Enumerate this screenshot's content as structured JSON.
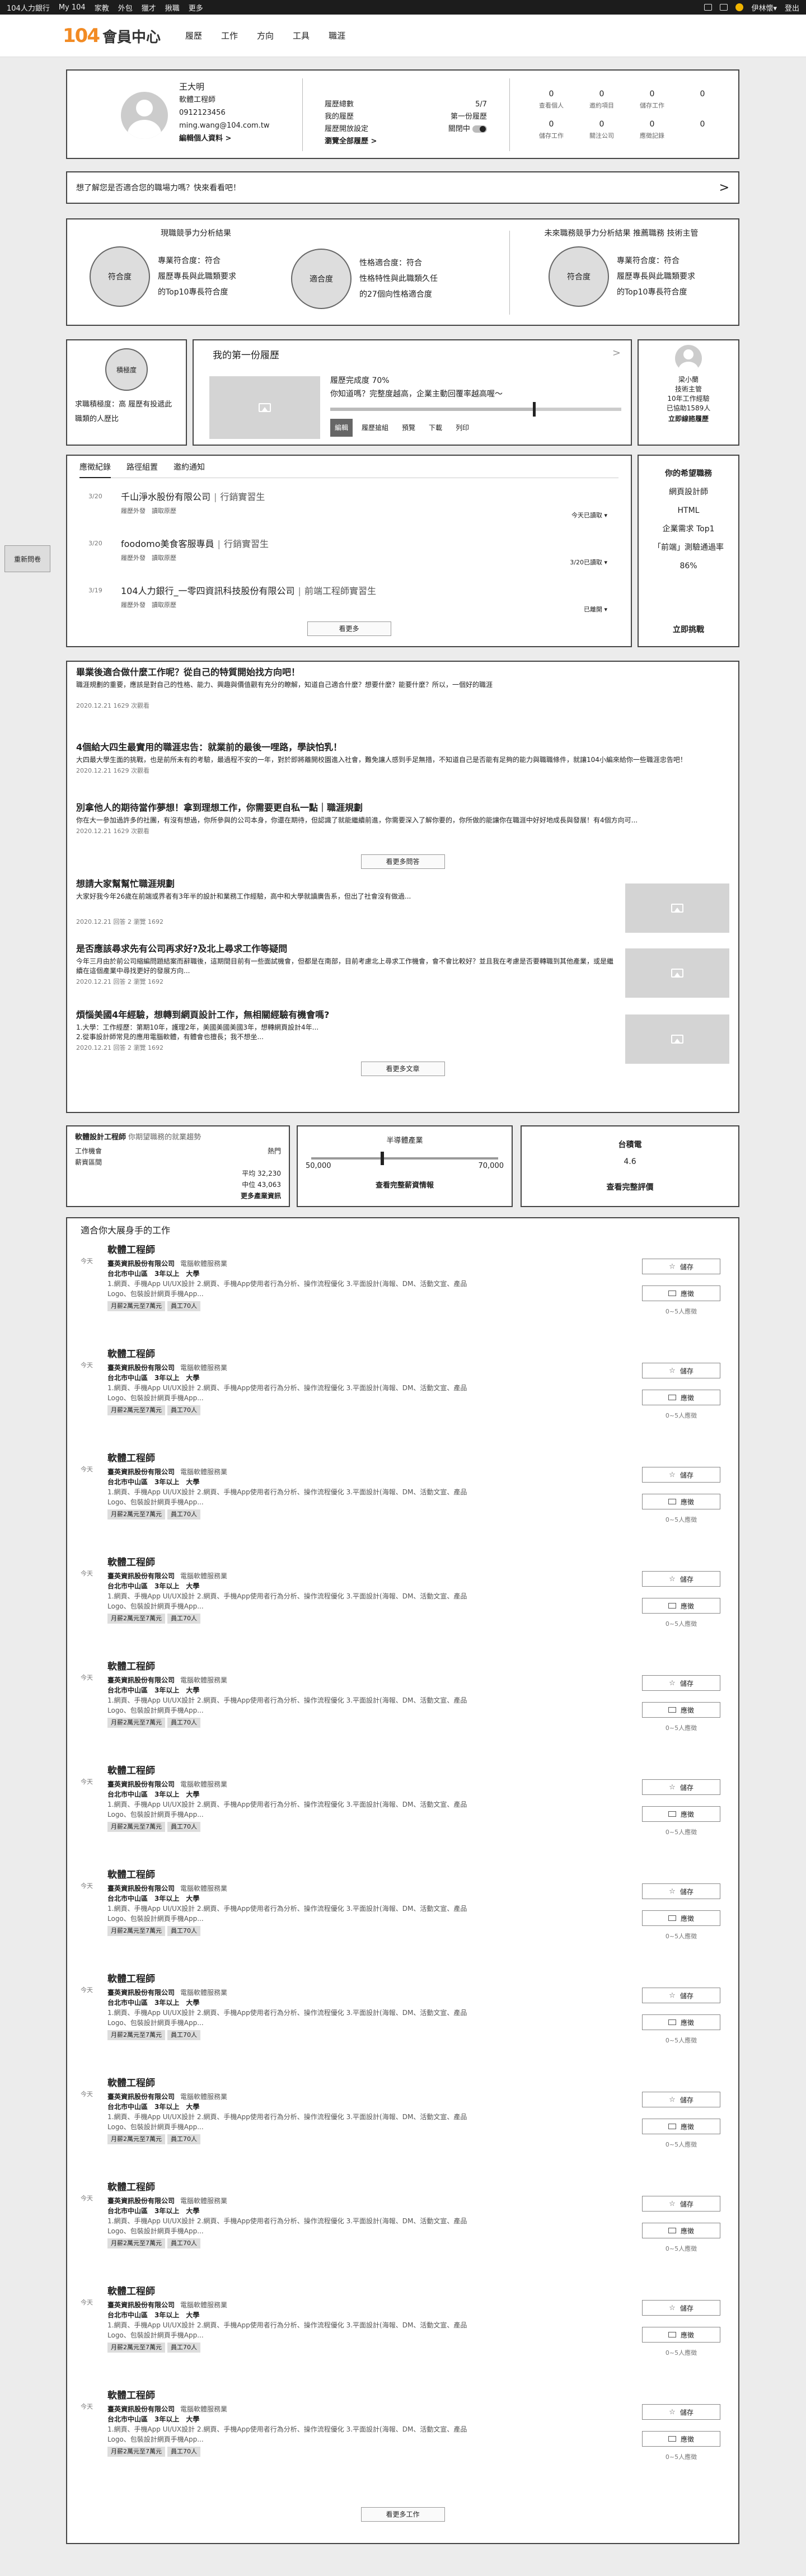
{
  "topbar": {
    "brand": "104人力銀行",
    "my": "My 104",
    "links": [
      "家教",
      "外包",
      "獵才",
      "揪職",
      "更多"
    ],
    "user": "伊林懷▾",
    "logout": "登出"
  },
  "header": {
    "logo_num": "104",
    "logo_text": "會員中心",
    "nav": [
      "履歷",
      "工作",
      "方向",
      "工具",
      "職涯"
    ]
  },
  "profile": {
    "name": "王大明",
    "title": "軟體工程師",
    "phone": "0912123456",
    "email": "ming.wang@104.com.tw",
    "edit": "編輯個人資料 >",
    "stats": [
      {
        "label": "履歷總數",
        "value": "5/7"
      },
      {
        "label": "我的履歷",
        "value": "第一份履歷"
      },
      {
        "label": "履歷開放設定",
        "value": "關閉中"
      }
    ],
    "view_settings": "瀏覽全部履歷 >",
    "counts": [
      {
        "n": "0",
        "l": "查看個人"
      },
      {
        "n": "0",
        "l": "邀約項目"
      },
      {
        "n": "0",
        "l": "儲存工作"
      },
      {
        "n": "0",
        "l": ""
      },
      {
        "n": "0",
        "l": "儲存工作"
      },
      {
        "n": "0",
        "l": "關注公司"
      },
      {
        "n": "0",
        "l": "應徵記錄"
      },
      {
        "n": "0",
        "l": ""
      }
    ]
  },
  "banner": {
    "text": "想了解您是否適合您的職場力嗎？快來看看吧！",
    "arrow": ">"
  },
  "analysis": [
    {
      "title": "現職競爭力分析結果",
      "circle": "符合度",
      "lines": [
        "專業符合度：符合",
        "履歷專長與此職類要求",
        "的Top10專長符合度"
      ]
    },
    {
      "title": "",
      "circle": "適合度",
      "lines": [
        "性格適合度：符合",
        "性格特性與此職類久任",
        "的27個向性格適合度"
      ]
    },
    {
      "title": "未來職務競爭力分析結果 推薦職務 技術主管",
      "circle": "符合度",
      "lines": [
        "專業符合度：符合",
        "履歷專長與此職類要求",
        "的Top10專長符合度"
      ]
    }
  ],
  "fortune": {
    "circle": "積極度",
    "text": "求職積極度：高 履歷有投遞此職類的人歷比"
  },
  "resume": {
    "title": "我的第一份履歷",
    "arrow": ">",
    "complete": "履歷完成度 70%",
    "hint": "你知道嗎？完整度越高，企業主動回覆率越高喔～",
    "progress": 0.7,
    "buttons": [
      "編輯",
      "履歷搶組",
      "預覽",
      "下載",
      "列印"
    ]
  },
  "advisor": {
    "name": "梁小蘭",
    "role": "技術主管",
    "years": "10年工作經驗",
    "helped": "已協助1589人",
    "link": "立即線諮履歷"
  },
  "side_button": "重新問卷",
  "records": {
    "tabs": [
      "應徵紀錄",
      "路徑組置",
      "邀約通知"
    ],
    "items": [
      {
        "date": "3/20",
        "company": "千山淨水股份有限公司",
        "job": "行銷實習生",
        "sub": "履歷外發　讀取原歷",
        "status": "今天已讀取 ▾"
      },
      {
        "date": "3/20",
        "company": "foodomo美食客服專員",
        "job": "行銷實習生",
        "sub": "履歷外發　讀取原歷",
        "status": "3/20已讀取 ▾"
      },
      {
        "date": "3/19",
        "company": "104人力銀行_一零四資訊科技股份有限公司",
        "job": "前端工程師實習生",
        "sub": "履歷外發　讀取原歷",
        "status": "已離開 ▾"
      }
    ],
    "more": "看更多"
  },
  "wish": {
    "title": "你的希望職務",
    "lines": [
      "網頁設計師",
      "HTML",
      "企業需求 Top1",
      "「前端」測驗通過率",
      "86%"
    ],
    "link": "立即挑戰"
  },
  "articles": {
    "items": [
      {
        "title": "畢業後適合做什麼工作呢？從自己的特質開始找方向吧！",
        "body": "職涯規劃的重要，應該是對自己的性格、能力、興趣與價值觀有充分的瞭解，知道自己適合什麼？想要什麼？能要什麼？所以，一個好的職涯",
        "meta": "2020.12.21 1629 次觀看"
      },
      {
        "title": "4個給大四生最實用的職涯忠告：就業前的最後一哩路，學訣怕乳！",
        "body": "大四最大學生面的挑戰，也是前所未有的考驗，最過程不安的一年，對於即將離開校園進入社會，難免讓人感到手足無措，不知道自己是否能有足夠的能力與職職條件，就讓104小編來給你一些職涯忠告吧！",
        "meta": "2020.12.21 1629 次觀看"
      },
      {
        "title": "別拿他人的期待當作夢想！拿到理想工作，你需要更自私一點｜職涯規劃",
        "body": "你在大一參加過許多的社團，有沒有想過，你所參與的公司本身，你還在期待，但認識了就能繼續前進，你需要深入了解你要的，你所做的能讓你在職涯中好好地成長與發展！有4個方向可...",
        "meta": "2020.12.21 1629 次觀看"
      }
    ],
    "more1": "看更多問答",
    "qa": [
      {
        "title": "想請大家幫幫忙職涯規劃",
        "body": "大家好我今年26歲在前端或界者有3年半的設計和業務工作經驗，高中和大學就讀廣告系，但出了社會沒有做過...",
        "meta": "2020.12.21 回答 2 瀏覽 1692"
      },
      {
        "title": "是否應該尋求先有公司再求好?及北上尋求工作等疑問",
        "body": "今年三月由於前公司縮編問題結案而辭職後，這期間目前有一些面試機會，但都是在南部，目前考慮北上尋求工作機會，會不會比較好？並且我在考慮是否要轉職到其他產業，或是繼續在這個產業中尋找更好的發展方向...",
        "meta": "2020.12.21 回答 2 瀏覽 1692"
      },
      {
        "title": "煩惱美國4年經驗，想轉到網頁設計工作，無相關經驗有機會嗎?",
        "body": "1.大學：工作經歷：第期10年，護理2年，美國美國美國3年，想轉網頁設計4年...\n2.從事設計師常見的應用電腦軟體，有體會也擅長；我不想坐...",
        "meta": "2020.12.21 回答 2 瀏覽 1692"
      }
    ],
    "more2": "看更多文章"
  },
  "salary": {
    "job": "軟體設計工程師",
    "suffix": "你期望職務的就業趨勢",
    "rows": [
      {
        "label": "工作機會",
        "value": "熱門"
      },
      {
        "label": "薪資區間",
        "value": ""
      },
      {
        "label": "",
        "value": "平均 32,230"
      },
      {
        "label": "",
        "value": "中位 43,063"
      }
    ],
    "link": "更多產業資訊"
  },
  "range": {
    "title": "半導體產業",
    "min": "50,000",
    "max": "70,000",
    "position": 0.38,
    "link": "查看完整薪資情報"
  },
  "company": {
    "name": "台積電",
    "score": "4.6",
    "link": "查看完整評價"
  },
  "jobs": {
    "title": "適合你大展身手的工作",
    "items": [
      {
        "date": "今天",
        "name": "軟體工程師",
        "company": "臺英資訊股份有限公司",
        "category": "電腦軟體服務業",
        "location": "台北市中山區　3年以上　大學",
        "desc": "1.網頁、手機App UI/UX設計 2.網頁、手機App使用者行為分析、操作流程優化 3.平面設計(海報、DM、活動文宣、產品Logo、包裝設計網頁手機App...",
        "tags": [
          "月薪2萬元至7萬元",
          "員工70人"
        ],
        "save": "儲存",
        "apply": "應徵",
        "applicants": "0~5人應徵"
      },
      {
        "date": "今天",
        "name": "軟體工程師",
        "company": "臺英資訊股份有限公司",
        "category": "電腦軟體服務業",
        "location": "台北市中山區　3年以上　大學",
        "desc": "1.網頁、手機App UI/UX設計 2.網頁、手機App使用者行為分析、操作流程優化 3.平面設計(海報、DM、活動文宣、產品Logo、包裝設計網頁手機App...",
        "tags": [
          "月薪2萬元至7萬元",
          "員工70人"
        ],
        "save": "儲存",
        "apply": "應徵",
        "applicants": "0~5人應徵"
      },
      {
        "date": "今天",
        "name": "軟體工程師",
        "company": "臺英資訊股份有限公司",
        "category": "電腦軟體服務業",
        "location": "台北市中山區　3年以上　大學",
        "desc": "1.網頁、手機App UI/UX設計 2.網頁、手機App使用者行為分析、操作流程優化 3.平面設計(海報、DM、活動文宣、產品Logo、包裝設計網頁手機App...",
        "tags": [
          "月薪2萬元至7萬元",
          "員工70人"
        ],
        "save": "儲存",
        "apply": "應徵",
        "applicants": "0~5人應徵"
      },
      {
        "date": "今天",
        "name": "軟體工程師",
        "company": "臺英資訊股份有限公司",
        "category": "電腦軟體服務業",
        "location": "台北市中山區　3年以上　大學",
        "desc": "1.網頁、手機App UI/UX設計 2.網頁、手機App使用者行為分析、操作流程優化 3.平面設計(海報、DM、活動文宣、產品Logo、包裝設計網頁手機App...",
        "tags": [
          "月薪2萬元至7萬元",
          "員工70人"
        ],
        "save": "儲存",
        "apply": "應徵",
        "applicants": "0~5人應徵"
      },
      {
        "date": "今天",
        "name": "軟體工程師",
        "company": "臺英資訊股份有限公司",
        "category": "電腦軟體服務業",
        "location": "台北市中山區　3年以上　大學",
        "desc": "1.網頁、手機App UI/UX設計 2.網頁、手機App使用者行為分析、操作流程優化 3.平面設計(海報、DM、活動文宣、產品Logo、包裝設計網頁手機App...",
        "tags": [
          "月薪2萬元至7萬元",
          "員工70人"
        ],
        "save": "儲存",
        "apply": "應徵",
        "applicants": "0~5人應徵"
      },
      {
        "date": "今天",
        "name": "軟體工程師",
        "company": "臺英資訊股份有限公司",
        "category": "電腦軟體服務業",
        "location": "台北市中山區　3年以上　大學",
        "desc": "1.網頁、手機App UI/UX設計 2.網頁、手機App使用者行為分析、操作流程優化 3.平面設計(海報、DM、活動文宣、產品Logo、包裝設計網頁手機App...",
        "tags": [
          "月薪2萬元至7萬元",
          "員工70人"
        ],
        "save": "儲存",
        "apply": "應徵",
        "applicants": "0~5人應徵"
      },
      {
        "date": "今天",
        "name": "軟體工程師",
        "company": "臺英資訊股份有限公司",
        "category": "電腦軟體服務業",
        "location": "台北市中山區　3年以上　大學",
        "desc": "1.網頁、手機App UI/UX設計 2.網頁、手機App使用者行為分析、操作流程優化 3.平面設計(海報、DM、活動文宣、產品Logo、包裝設計網頁手機App...",
        "tags": [
          "月薪2萬元至7萬元",
          "員工70人"
        ],
        "save": "儲存",
        "apply": "應徵",
        "applicants": "0~5人應徵"
      },
      {
        "date": "今天",
        "name": "軟體工程師",
        "company": "臺英資訊股份有限公司",
        "category": "電腦軟體服務業",
        "location": "台北市中山區　3年以上　大學",
        "desc": "1.網頁、手機App UI/UX設計 2.網頁、手機App使用者行為分析、操作流程優化 3.平面設計(海報、DM、活動文宣、產品Logo、包裝設計網頁手機App...",
        "tags": [
          "月薪2萬元至7萬元",
          "員工70人"
        ],
        "save": "儲存",
        "apply": "應徵",
        "applicants": "0~5人應徵"
      },
      {
        "date": "今天",
        "name": "軟體工程師",
        "company": "臺英資訊股份有限公司",
        "category": "電腦軟體服務業",
        "location": "台北市中山區　3年以上　大學",
        "desc": "1.網頁、手機App UI/UX設計 2.網頁、手機App使用者行為分析、操作流程優化 3.平面設計(海報、DM、活動文宣、產品Logo、包裝設計網頁手機App...",
        "tags": [
          "月薪2萬元至7萬元",
          "員工70人"
        ],
        "save": "儲存",
        "apply": "應徵",
        "applicants": "0~5人應徵"
      },
      {
        "date": "今天",
        "name": "軟體工程師",
        "company": "臺英資訊股份有限公司",
        "category": "電腦軟體服務業",
        "location": "台北市中山區　3年以上　大學",
        "desc": "1.網頁、手機App UI/UX設計 2.網頁、手機App使用者行為分析、操作流程優化 3.平面設計(海報、DM、活動文宣、產品Logo、包裝設計網頁手機App...",
        "tags": [
          "月薪2萬元至7萬元",
          "員工70人"
        ],
        "save": "儲存",
        "apply": "應徵",
        "applicants": "0~5人應徵"
      },
      {
        "date": "今天",
        "name": "軟體工程師",
        "company": "臺英資訊股份有限公司",
        "category": "電腦軟體服務業",
        "location": "台北市中山區　3年以上　大學",
        "desc": "1.網頁、手機App UI/UX設計 2.網頁、手機App使用者行為分析、操作流程優化 3.平面設計(海報、DM、活動文宣、產品Logo、包裝設計網頁手機App...",
        "tags": [
          "月薪2萬元至7萬元",
          "員工70人"
        ],
        "save": "儲存",
        "apply": "應徵",
        "applicants": "0~5人應徵"
      },
      {
        "date": "今天",
        "name": "軟體工程師",
        "company": "臺英資訊股份有限公司",
        "category": "電腦軟體服務業",
        "location": "台北市中山區　3年以上　大學",
        "desc": "1.網頁、手機App UI/UX設計 2.網頁、手機App使用者行為分析、操作流程優化 3.平面設計(海報、DM、活動文宣、產品Logo、包裝設計網頁手機App...",
        "tags": [
          "月薪2萬元至7萬元",
          "員工70人"
        ],
        "save": "儲存",
        "apply": "應徵",
        "applicants": "0~5人應徵"
      }
    ],
    "more": "看更多工作"
  }
}
